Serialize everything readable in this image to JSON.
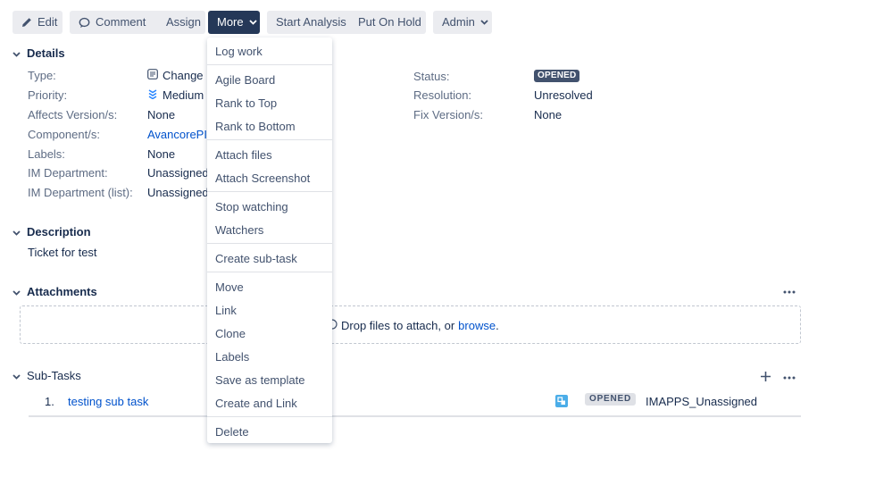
{
  "toolbar": {
    "edit_label": "Edit",
    "comment_label": "Comment",
    "assign_label": "Assign",
    "more_label": "More",
    "start_analysis_label": "Start Analysis",
    "put_on_hold_label": "Put On Hold",
    "admin_label": "Admin"
  },
  "details": {
    "title": "Details",
    "type_label": "Type:",
    "type_value": "Change R",
    "priority_label": "Priority:",
    "priority_value": "Medium",
    "affects_label": "Affects Version/s:",
    "affects_value": "None",
    "component_label": "Component/s:",
    "component_value": "AvancorePIF",
    "labels_label": "Labels:",
    "labels_value": "None",
    "imdept_label": "IM Department:",
    "imdept_value": "Unassigned",
    "imdeptlist_label": "IM Department (list):",
    "imdeptlist_value": "Unassigned",
    "status_label": "Status:",
    "status_value": "OPENED",
    "resolution_label": "Resolution:",
    "resolution_value": "Unresolved",
    "fix_label": "Fix Version/s:",
    "fix_value": "None"
  },
  "description": {
    "title": "Description",
    "text": "Ticket for test"
  },
  "attachments": {
    "title": "Attachments",
    "drop_text": "Drop files to attach, or",
    "browse_link": "browse",
    "period": "."
  },
  "subtasks": {
    "title": "Sub-Tasks",
    "rows": [
      {
        "num": "1.",
        "summary": "testing sub task",
        "status": "OPENED",
        "assignee": "IMAPPS_Unassigned"
      }
    ]
  },
  "more_menu": {
    "items": [
      "Log work",
      "Agile Board",
      "Rank to Top",
      "Rank to Bottom",
      "Attach files",
      "Attach Screenshot",
      "Stop watching",
      "Watchers",
      "Create sub-task",
      "Move",
      "Link",
      "Clone",
      "Labels",
      "Save as template",
      "Create and Link",
      "Delete"
    ]
  },
  "colors": {
    "accent": "#0052cc",
    "dark_button": "#253858",
    "button_bg": "#ebecf0",
    "status_dark": "#42526e"
  },
  "icons": {
    "edit": "pencil-icon",
    "comment": "speech-bubble-icon",
    "more_caret": "chevron-down-icon",
    "admin_caret": "chevron-down-icon",
    "type": "change-request-icon",
    "priority": "priority-medium-icon",
    "section_toggle": "chevron-down-icon",
    "drop": "upload-cloud-icon",
    "subtask_type": "subtask-icon",
    "add": "plus-icon",
    "more_actions": "ellipsis-icon"
  }
}
